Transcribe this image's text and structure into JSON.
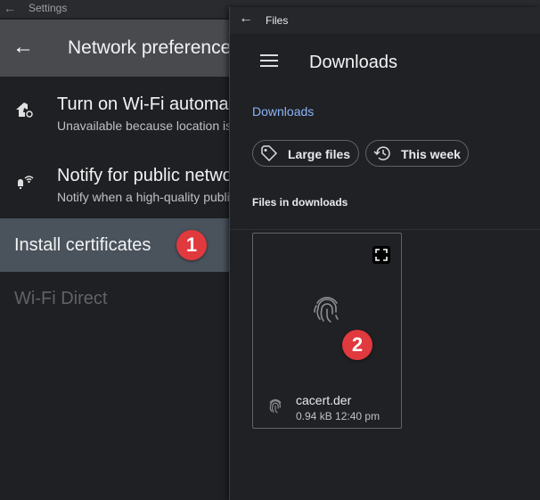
{
  "settings": {
    "window_title": "Settings",
    "page_title": "Network preferences",
    "items": [
      {
        "title": "Turn on Wi-Fi automatically",
        "subtitle": "Unavailable because location is turned off"
      },
      {
        "title": "Notify for public networks",
        "subtitle": "Notify when a high-quality public network is available"
      }
    ],
    "install_certificates": "Install certificates",
    "wifi_direct": "Wi-Fi Direct"
  },
  "files": {
    "window_title": "Files",
    "heading": "Downloads",
    "breadcrumb": "Downloads",
    "chips": [
      {
        "label": "Large files"
      },
      {
        "label": "This week"
      }
    ],
    "section_label": "Files in downloads",
    "file": {
      "name": "cacert.der",
      "size": "0.94 kB",
      "time": "12:40 pm"
    }
  },
  "badges": {
    "first": "1",
    "second": "2"
  },
  "colors": {
    "badge": "#e0393e",
    "link": "#8ab4f8",
    "highlight": "#4a525c",
    "appbar": "#494a4d"
  }
}
